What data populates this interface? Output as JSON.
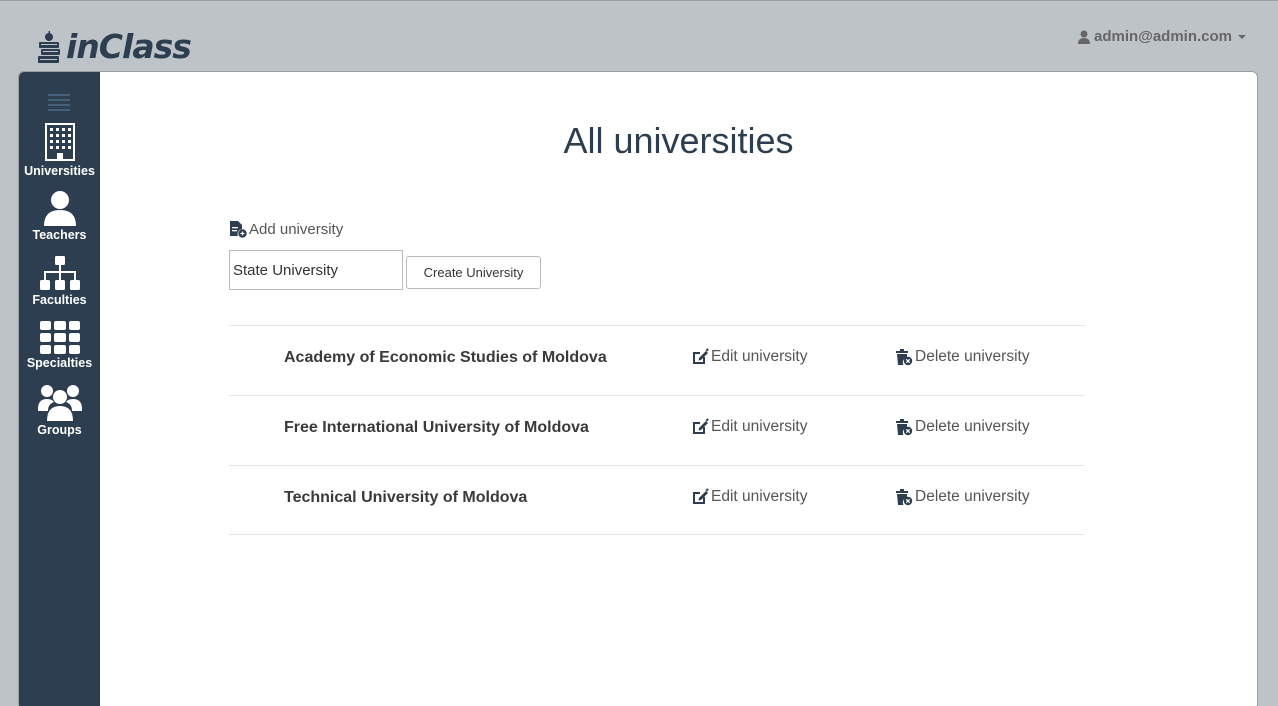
{
  "header": {
    "logo_text": "inClass",
    "user_email": "admin@admin.com"
  },
  "sidebar": {
    "items": [
      {
        "label": "Universities",
        "icon": "building-icon"
      },
      {
        "label": "Teachers",
        "icon": "user-icon"
      },
      {
        "label": "Faculties",
        "icon": "sitemap-icon"
      },
      {
        "label": "Specialties",
        "icon": "grid-icon"
      },
      {
        "label": "Groups",
        "icon": "users-icon"
      }
    ]
  },
  "main": {
    "title": "All universities",
    "add_label": "Add university",
    "input_value": "State University",
    "create_button": "Create University",
    "universities": [
      {
        "name": "Academy of Economic Studies of Moldova",
        "edit": "Edit university",
        "delete": "Delete university"
      },
      {
        "name": "Free International University of Moldova",
        "edit": "Edit university",
        "delete": "Delete university"
      },
      {
        "name": "Technical University of Moldova",
        "edit": "Edit university",
        "delete": "Delete university"
      }
    ]
  },
  "colors": {
    "sidebar_bg": "#2c3e50",
    "page_bg": "#bdc3c7",
    "text_dark": "#2c3e50"
  }
}
